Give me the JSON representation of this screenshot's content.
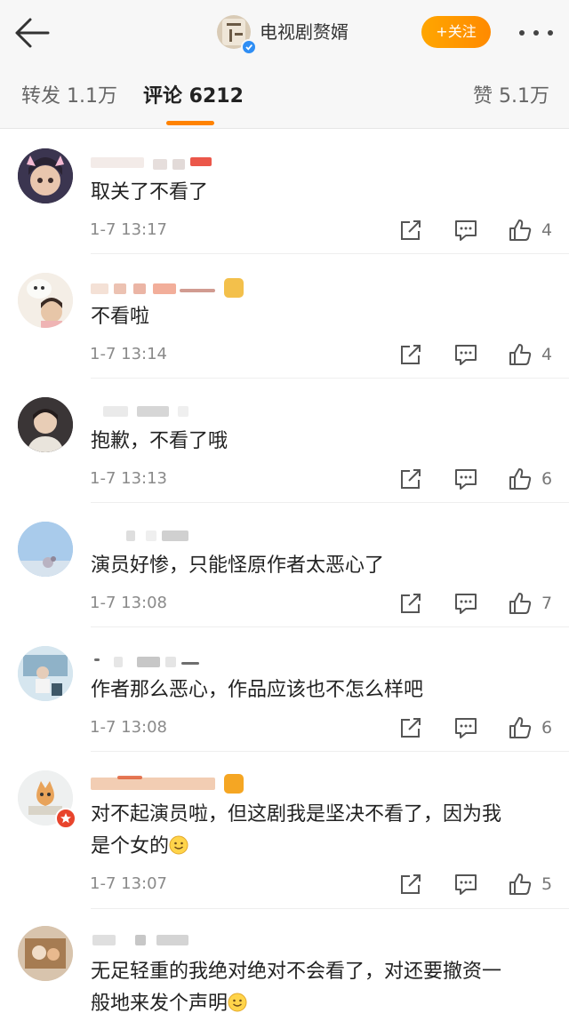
{
  "header": {
    "account_name": "电视剧赘婿",
    "follow_label": "+关注",
    "icons": [
      "back-arrow-icon",
      "verified-icon",
      "more-icon"
    ]
  },
  "tabs": [
    {
      "label": "转发 1.1万",
      "active": false
    },
    {
      "label": "评论 6212",
      "active": true
    },
    {
      "label": "赞 5.1万",
      "active": false
    }
  ],
  "comments": [
    {
      "text": "取关了不看了",
      "time": "1-7 13:17",
      "likes": "4"
    },
    {
      "text": "不看啦",
      "time": "1-7 13:14",
      "likes": "4"
    },
    {
      "text": "抱歉，不看了哦",
      "time": "1-7 13:13",
      "likes": "6"
    },
    {
      "text": "演员好惨，只能怪原作者太恶心了",
      "time": "1-7 13:08",
      "likes": "7"
    },
    {
      "text": "作者那么恶心，作品应该也不怎么样吧",
      "time": "1-7 13:08",
      "likes": "6"
    },
    {
      "text_line1": "对不起演员啦，但这剧我是坚决不看了，因为我",
      "text_line2": "是个女的",
      "emoji": "smile-emoji",
      "time": "1-7 13:07",
      "likes": "5"
    },
    {
      "text_line1": "无足轻重的我绝对绝对不会看了，对还要撤资一",
      "text_line2": "般地来发个声明",
      "emoji": "smile-emoji"
    }
  ],
  "colors": {
    "accent": "#ff8200",
    "follow_bg": "#ffa600",
    "text": "#222222",
    "meta": "#8a8a8a"
  }
}
